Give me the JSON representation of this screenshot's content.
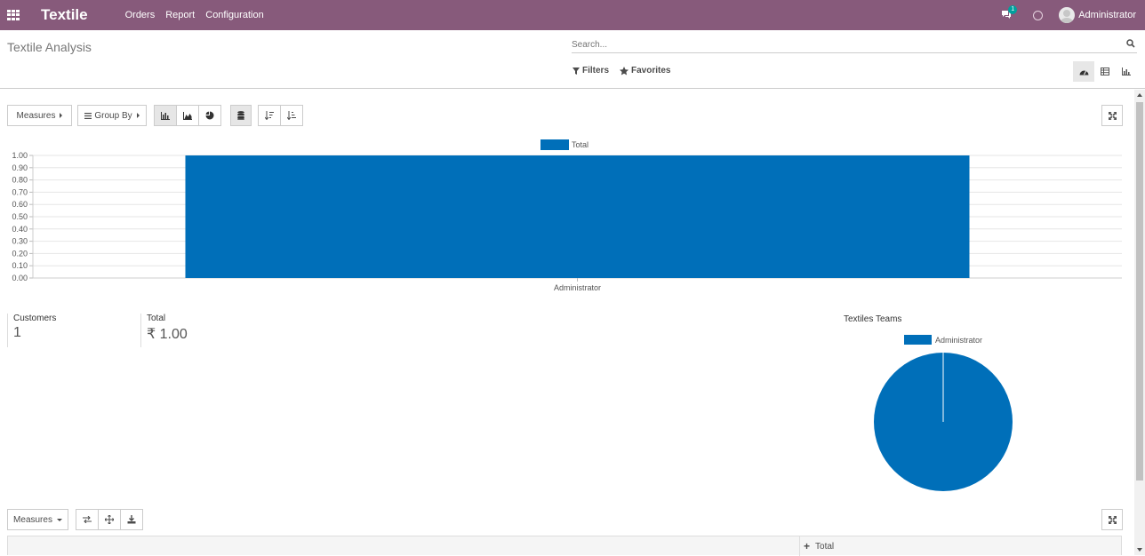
{
  "app": {
    "brand": "Textile"
  },
  "nav": {
    "menu": [
      "Orders",
      "Report",
      "Configuration"
    ],
    "chat_badge": "1",
    "user_name": "Administrator"
  },
  "control_panel": {
    "title": "Textile Analysis",
    "search_placeholder": "Search...",
    "filters_label": "Filters",
    "favorites_label": "Favorites"
  },
  "toolbar": {
    "measures_label": "Measures",
    "group_by_label": "Group By"
  },
  "chart_data": [
    {
      "type": "bar",
      "categories": [
        "Administrator"
      ],
      "series": [
        {
          "name": "Total",
          "values": [
            1.0
          ]
        }
      ],
      "ylim": [
        0,
        1.0
      ],
      "y_ticks": [
        "0.00",
        "0.10",
        "0.20",
        "0.30",
        "0.40",
        "0.50",
        "0.60",
        "0.70",
        "0.80",
        "0.90",
        "1.00"
      ],
      "legend": "top-center",
      "grid": true,
      "color": "#006fb9"
    },
    {
      "type": "pie",
      "title": "Textiles Teams",
      "labels": [
        "Administrator"
      ],
      "values": [
        1
      ],
      "legend": "top-center",
      "color": "#006fb9"
    }
  ],
  "kpis": [
    {
      "label": "Customers",
      "value": "1"
    },
    {
      "label": "Total",
      "value": "₹ 1.00"
    }
  ],
  "pivot": {
    "measures_label": "Measures",
    "total_header": "Total"
  }
}
